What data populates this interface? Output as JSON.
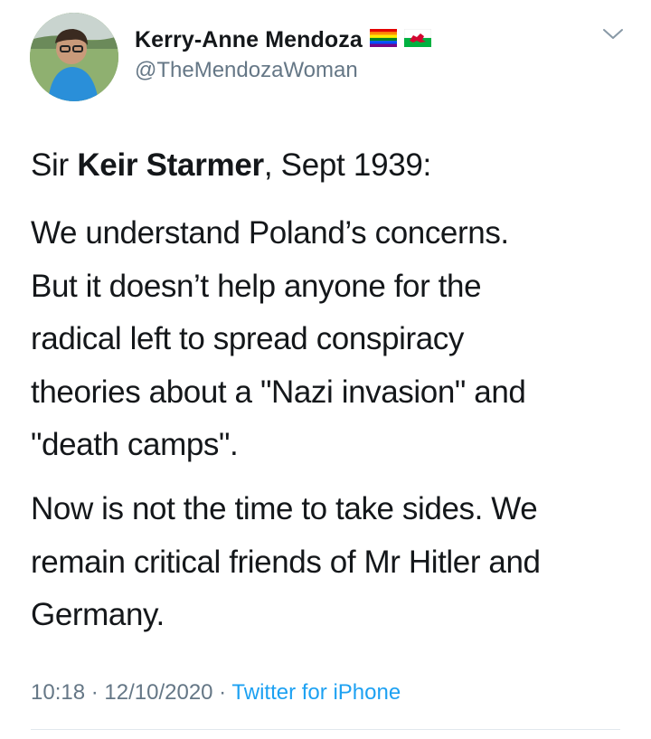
{
  "author": {
    "display_name": "Kerry-Anne Mendoza",
    "handle": "@TheMendozaWoman",
    "avatar_icon": "profile-photo",
    "flags": [
      "rainbow-flag-icon",
      "welsh-flag-icon"
    ]
  },
  "tweet": {
    "prefix": "Sir ",
    "bold_name": "Keir Starmer",
    "suffix": ", Sept 1939:",
    "paragraph_1": "We understand Poland’s concerns.\nBut it doesn’t help anyone for the\nradical left to spread conspiracy\ntheories about a \"Nazi invasion\" and\n\"death camps\".",
    "paragraph_2": "Now is not the time to take sides. We\nremain critical friends of Mr Hitler and\nGermany."
  },
  "meta": {
    "time": "10:18",
    "separator": " · ",
    "date": "12/10/2020",
    "source": "Twitter for iPhone"
  },
  "colors": {
    "text": "#14171a",
    "secondary": "#657786",
    "link": "#1da1f2",
    "divider": "#e1e8ed"
  }
}
